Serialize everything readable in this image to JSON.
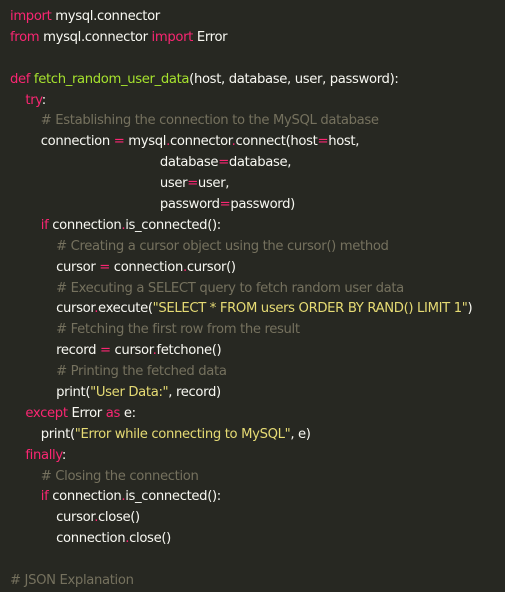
{
  "colors": {
    "background": "#272822",
    "plain": "#f8f8f2",
    "keyword": "#f92672",
    "function": "#a6e22e",
    "string": "#e6db74",
    "comment": "#75715e"
  },
  "lines": [
    [
      {
        "t": "import",
        "k": "kw"
      },
      {
        "t": " mysql.connector",
        "k": "plain"
      }
    ],
    [
      {
        "t": "from",
        "k": "kw"
      },
      {
        "t": " mysql.connector ",
        "k": "plain"
      },
      {
        "t": "import",
        "k": "kw"
      },
      {
        "t": " Error",
        "k": "plain"
      }
    ],
    [],
    [
      {
        "t": "def",
        "k": "kw"
      },
      {
        "t": " ",
        "k": "plain"
      },
      {
        "t": "fetch_random_user_data",
        "k": "fn"
      },
      {
        "t": "(host, database, user, password):",
        "k": "plain"
      }
    ],
    [
      {
        "t": "    ",
        "k": "plain"
      },
      {
        "t": "try",
        "k": "kw"
      },
      {
        "t": ":",
        "k": "plain"
      }
    ],
    [
      {
        "t": "        ",
        "k": "plain"
      },
      {
        "t": "# Establishing the connection to the MySQL database",
        "k": "cm"
      }
    ],
    [
      {
        "t": "        connection ",
        "k": "plain"
      },
      {
        "t": "=",
        "k": "kw"
      },
      {
        "t": " mysql",
        "k": "plain"
      },
      {
        "t": ".",
        "k": "kw"
      },
      {
        "t": "connector",
        "k": "plain"
      },
      {
        "t": ".",
        "k": "kw"
      },
      {
        "t": "connect(host",
        "k": "plain"
      },
      {
        "t": "=",
        "k": "kw"
      },
      {
        "t": "host,",
        "k": "plain"
      }
    ],
    [
      {
        "t": "                                       database",
        "k": "plain"
      },
      {
        "t": "=",
        "k": "kw"
      },
      {
        "t": "database,",
        "k": "plain"
      }
    ],
    [
      {
        "t": "                                       user",
        "k": "plain"
      },
      {
        "t": "=",
        "k": "kw"
      },
      {
        "t": "user,",
        "k": "plain"
      }
    ],
    [
      {
        "t": "                                       password",
        "k": "plain"
      },
      {
        "t": "=",
        "k": "kw"
      },
      {
        "t": "password)",
        "k": "plain"
      }
    ],
    [
      {
        "t": "        ",
        "k": "plain"
      },
      {
        "t": "if",
        "k": "kw"
      },
      {
        "t": " connection",
        "k": "plain"
      },
      {
        "t": ".",
        "k": "kw"
      },
      {
        "t": "is_connected():",
        "k": "plain"
      }
    ],
    [
      {
        "t": "            ",
        "k": "plain"
      },
      {
        "t": "# Creating a cursor object using the cursor() method",
        "k": "cm"
      }
    ],
    [
      {
        "t": "            cursor ",
        "k": "plain"
      },
      {
        "t": "=",
        "k": "kw"
      },
      {
        "t": " connection",
        "k": "plain"
      },
      {
        "t": ".",
        "k": "kw"
      },
      {
        "t": "cursor()",
        "k": "plain"
      }
    ],
    [
      {
        "t": "            ",
        "k": "plain"
      },
      {
        "t": "# Executing a SELECT query to fetch random user data",
        "k": "cm"
      }
    ],
    [
      {
        "t": "            cursor",
        "k": "plain"
      },
      {
        "t": ".",
        "k": "kw"
      },
      {
        "t": "execute(",
        "k": "plain"
      },
      {
        "t": "\"SELECT * FROM users ORDER BY RAND() LIMIT 1\"",
        "k": "str"
      },
      {
        "t": ")",
        "k": "plain"
      }
    ],
    [
      {
        "t": "            ",
        "k": "plain"
      },
      {
        "t": "# Fetching the first row from the result",
        "k": "cm"
      }
    ],
    [
      {
        "t": "            record ",
        "k": "plain"
      },
      {
        "t": "=",
        "k": "kw"
      },
      {
        "t": " cursor",
        "k": "plain"
      },
      {
        "t": ".",
        "k": "kw"
      },
      {
        "t": "fetchone()",
        "k": "plain"
      }
    ],
    [
      {
        "t": "            ",
        "k": "plain"
      },
      {
        "t": "# Printing the fetched data",
        "k": "cm"
      }
    ],
    [
      {
        "t": "            print(",
        "k": "plain"
      },
      {
        "t": "\"User Data:\"",
        "k": "str"
      },
      {
        "t": ", record)",
        "k": "plain"
      }
    ],
    [
      {
        "t": "    ",
        "k": "plain"
      },
      {
        "t": "except",
        "k": "kw"
      },
      {
        "t": " Error ",
        "k": "plain"
      },
      {
        "t": "as",
        "k": "kw"
      },
      {
        "t": " e:",
        "k": "plain"
      }
    ],
    [
      {
        "t": "        print(",
        "k": "plain"
      },
      {
        "t": "\"Error while connecting to MySQL\"",
        "k": "str"
      },
      {
        "t": ", e)",
        "k": "plain"
      }
    ],
    [
      {
        "t": "    ",
        "k": "plain"
      },
      {
        "t": "finally",
        "k": "kw"
      },
      {
        "t": ":",
        "k": "plain"
      }
    ],
    [
      {
        "t": "        ",
        "k": "plain"
      },
      {
        "t": "# Closing the connection",
        "k": "cm"
      }
    ],
    [
      {
        "t": "        ",
        "k": "plain"
      },
      {
        "t": "if",
        "k": "kw"
      },
      {
        "t": " connection",
        "k": "plain"
      },
      {
        "t": ".",
        "k": "kw"
      },
      {
        "t": "is_connected():",
        "k": "plain"
      }
    ],
    [
      {
        "t": "            cursor",
        "k": "plain"
      },
      {
        "t": ".",
        "k": "kw"
      },
      {
        "t": "close()",
        "k": "plain"
      }
    ],
    [
      {
        "t": "            connection",
        "k": "plain"
      },
      {
        "t": ".",
        "k": "kw"
      },
      {
        "t": "close()",
        "k": "plain"
      }
    ],
    [],
    [
      {
        "t": "# JSON Explanation",
        "k": "cm"
      }
    ]
  ]
}
